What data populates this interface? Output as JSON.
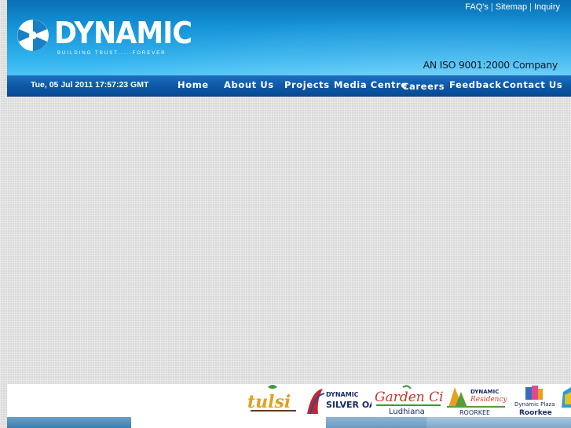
{
  "header": {
    "logo_text": "DYNAMIC",
    "logo_tagline": "BUILDING TRUST.....FOREVER",
    "top_links": [
      "FAQ's",
      "Sitemap",
      "Inquiry"
    ],
    "iso_text": "AN ISO 9001:2000  Company"
  },
  "navbar": {
    "date": "Tue, 05 Jul 2011 17:57:23 GMT",
    "items": [
      "Home",
      "About Us",
      "Projects",
      "Media Centre",
      "Careers",
      "Feedback",
      "Contact Us"
    ]
  },
  "banner": {
    "brands": [
      {
        "name": "tulsi",
        "sub": ""
      },
      {
        "name": "DYNAMIC",
        "sub": "SILVER OAK"
      },
      {
        "name": "Garden City",
        "sub": "Ludhiana"
      },
      {
        "name": "DYNAMIC Residency",
        "sub": "ROORKEE"
      },
      {
        "name": "Dynamic Plaza",
        "sub": "Roorkee"
      }
    ]
  },
  "colors": {
    "header_top": "#0a6fb4",
    "header_bottom": "#4cc4f6",
    "navbar": "#0c57a6",
    "background": "#d9d9d9"
  }
}
